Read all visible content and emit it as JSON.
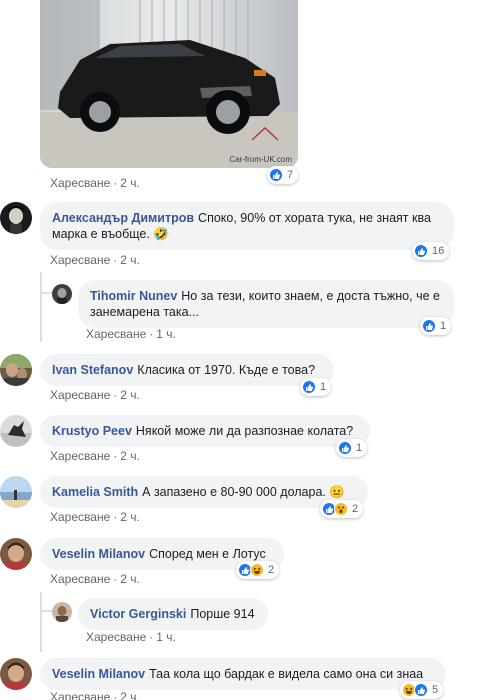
{
  "photo_comment": {
    "watermark": "Car-from-UK.com",
    "actions": {
      "like": "Харесване",
      "time": "2 ч."
    },
    "reactions": {
      "count": "7"
    }
  },
  "comments": [
    {
      "author": "Александър Димитров",
      "text": "Споко, 90% от хората тука, не знаят ква марка е въобще. 🤣",
      "actions": {
        "like": "Харесване",
        "time": "2 ч."
      },
      "reactions": {
        "count": "16"
      }
    },
    {
      "author": "Tihomir Nunev",
      "text": "Но за тези, които знаем, е доста тъжно, че е занемарена така...",
      "actions": {
        "like": "Харесване",
        "time": "1 ч."
      },
      "reactions": {
        "count": "1"
      }
    },
    {
      "author": "Ivan Stefanov",
      "text": "Класика от 1970. Къде е това?",
      "actions": {
        "like": "Харесване",
        "time": "2 ч."
      },
      "reactions": {
        "count": "1"
      }
    },
    {
      "author": "Krustyo Peev",
      "text": "Някой може ли да разпознае колата?",
      "actions": {
        "like": "Харесване",
        "time": "2 ч."
      },
      "reactions": {
        "count": "1"
      }
    },
    {
      "author": "Kamelia Smith",
      "text": "А запазено е 80-90 000 долара. 😐",
      "actions": {
        "like": "Харесване",
        "time": "2 ч."
      },
      "reactions": {
        "count": "2"
      }
    },
    {
      "author": "Veselin Milanov",
      "text": "Според мен е Лотус",
      "actions": {
        "like": "Харесване",
        "time": "2 ч."
      },
      "reactions": {
        "count": "2"
      }
    },
    {
      "author": "Victor Gerginski",
      "text": "Порше 914",
      "actions": {
        "like": "Харесване",
        "time": "1 ч."
      }
    },
    {
      "author": "Veselin Milanov",
      "text": "Таа кола що бардак е видела само она си знаа",
      "actions": {
        "like": "Харесване",
        "time": "2 ч."
      },
      "reactions": {
        "count": "5"
      }
    }
  ],
  "action_separator": "·",
  "colors": {
    "author": "#385898",
    "like": "#1877f2",
    "haha": "#f7b928",
    "bubble": "#f2f3f5",
    "meta": "#606770"
  }
}
